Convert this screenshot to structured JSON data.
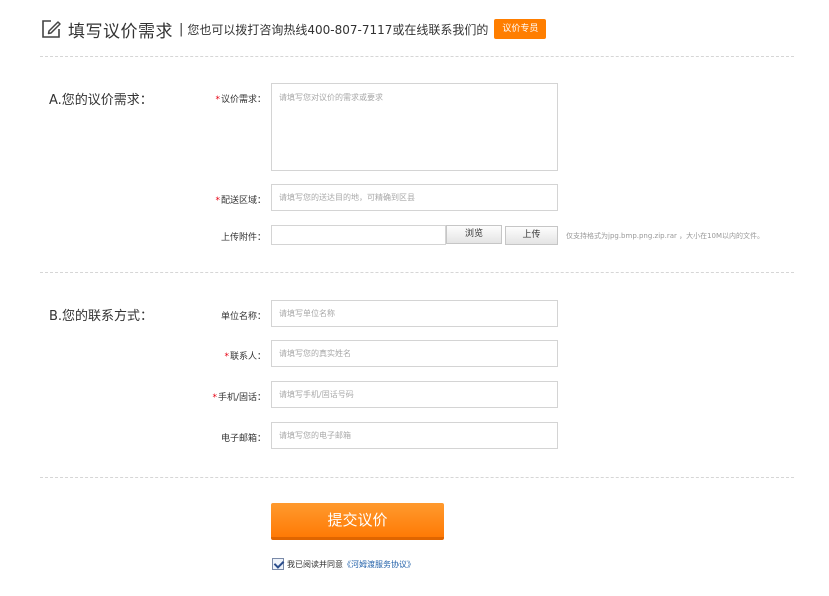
{
  "header": {
    "title": "填写议价需求",
    "separator": "|",
    "subtitle": "您也可以拨打咨询热线400-807-7117或在线联系我们的",
    "badge": "议价专员"
  },
  "section_a": {
    "title": "A.您的议价需求：",
    "demand": {
      "required": "*",
      "label": "议价需求：",
      "placeholder": "请填写您对议价的需求或要求"
    },
    "region": {
      "required": "*",
      "label": "配送区域：",
      "placeholder": "请填写您的送达目的地，可精确到区县"
    },
    "attachment": {
      "label": "上传附件：",
      "browse_label": "浏览",
      "upload_label": "上传",
      "hint": "仅支持格式为jpg.bmp.png.zip.rar ，大小在10M以内的文件。"
    }
  },
  "section_b": {
    "title": "B.您的联系方式：",
    "company": {
      "label": "单位名称：",
      "placeholder": "请填写单位名称"
    },
    "contact": {
      "required": "*",
      "label": "联系人：",
      "placeholder": "请填写您的真实姓名"
    },
    "phone": {
      "required": "*",
      "label": "手机/固话：",
      "placeholder": "请填写手机/固话号码"
    },
    "email": {
      "label": "电子邮箱：",
      "placeholder": "请填写您的电子邮箱"
    }
  },
  "submit_label": "提交议价",
  "agreement": {
    "checked": true,
    "text": "我已阅读并同意",
    "link": "《河姆渡服务协议》"
  },
  "colors": {
    "accent": "#ff7e00",
    "required": "#e60012",
    "link": "#1f5fa8"
  }
}
